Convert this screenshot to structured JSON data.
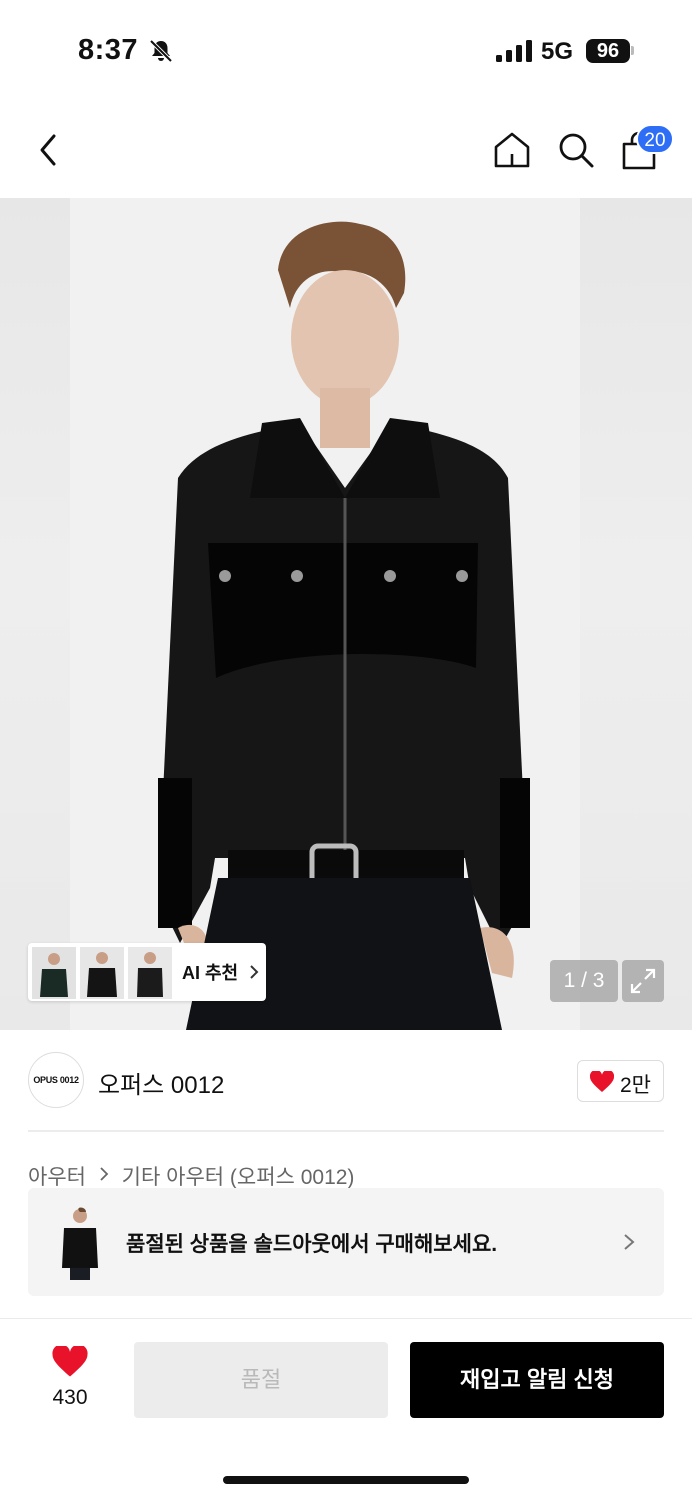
{
  "status_bar": {
    "time": "8:37",
    "network": "5G",
    "battery": "96"
  },
  "nav": {
    "cart_count": "20"
  },
  "hero": {
    "ai_label": "AI 추천",
    "counter": "1 / 3"
  },
  "brand": {
    "logo_text": "OPUS 0012",
    "name": "오퍼스 0012",
    "likes": "2만"
  },
  "breadcrumb": {
    "category": "아우터",
    "subcategory": "기타 아우터 (오퍼스 0012)"
  },
  "soldout_banner": {
    "text": "품절된 상품을 솔드아웃에서 구매해보세요."
  },
  "bottom_bar": {
    "wish_count": "430",
    "soldout_label": "품절",
    "restock_label": "재입고 알림 신청"
  },
  "colors": {
    "accent_blue": "#2e6df5",
    "heart_red": "#e8132a",
    "primary_black": "#000000"
  },
  "icons": [
    "bell-slash-icon",
    "signal-icon",
    "back-icon",
    "home-icon",
    "search-icon",
    "bag-icon",
    "chevron-right-icon",
    "expand-icon",
    "heart-icon"
  ]
}
